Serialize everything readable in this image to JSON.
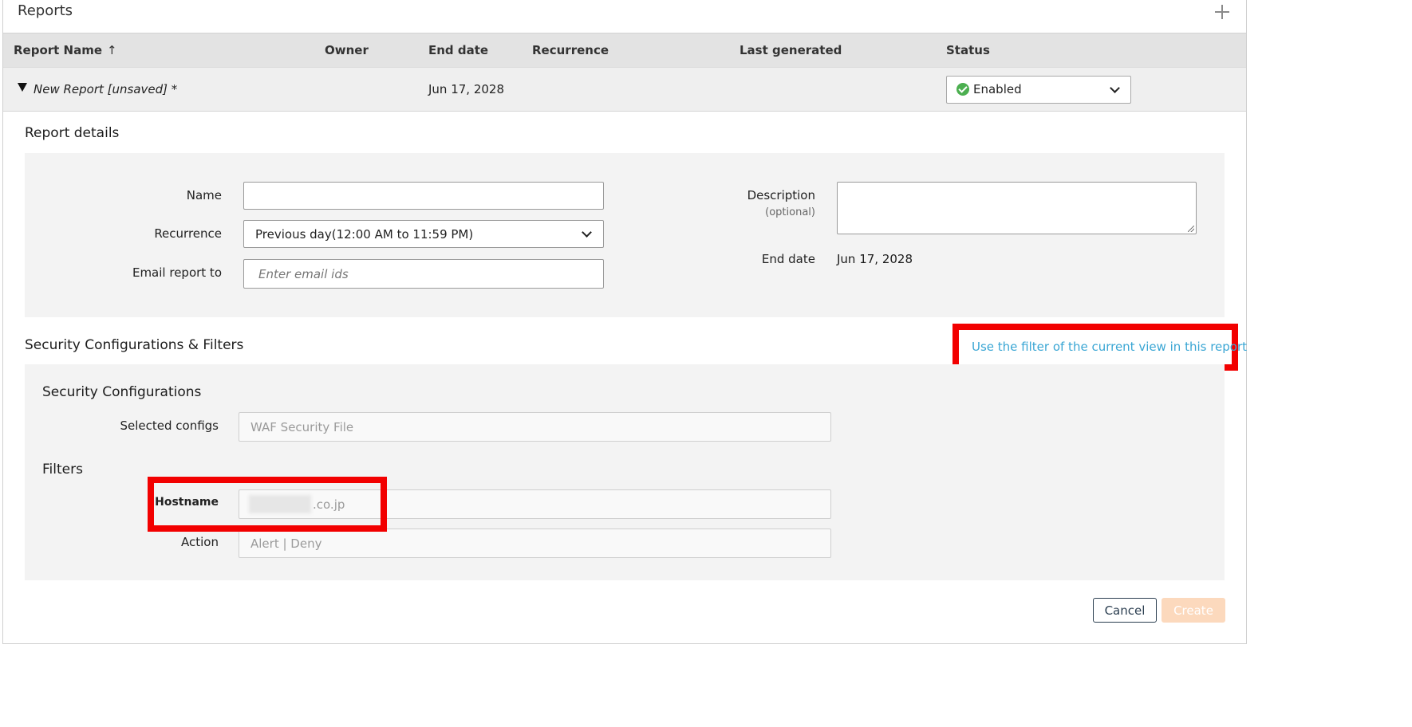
{
  "header": {
    "title": "Reports",
    "add_icon": "plus-icon"
  },
  "table": {
    "columns": [
      "Report Name",
      "Owner",
      "End date",
      "Recurrence",
      "Last generated",
      "Status"
    ],
    "sort_icon": "↑",
    "row": {
      "name": "New Report [unsaved] *",
      "owner": "",
      "end_date": "Jun 17, 2028",
      "recurrence": "",
      "last_generated": "",
      "status": "Enabled"
    }
  },
  "report_details": {
    "title": "Report details",
    "name_label": "Name",
    "name_value": "",
    "recurrence_label": "Recurrence",
    "recurrence_value": "Previous day(12:00 AM to 11:59 PM)",
    "email_label": "Email report to",
    "email_placeholder": "Enter email ids",
    "description_label": "Description",
    "description_sublabel": "(optional)",
    "end_date_label": "End date",
    "end_date_value": "Jun 17, 2028"
  },
  "security": {
    "title": "Security Configurations & Filters",
    "use_filter_link": "Use the filter of the current view in this report",
    "configs_title": "Security Configurations",
    "selected_configs_label": "Selected configs",
    "selected_configs_value": "WAF Security File",
    "filters_title": "Filters",
    "hostname_label": "Hostname",
    "hostname_value": ".co.jp",
    "action_label": "Action",
    "action_value": "Alert | Deny"
  },
  "footer": {
    "cancel_label": "Cancel",
    "create_label": "Create"
  },
  "colors": {
    "link": "#3aa6d4",
    "highlight": "#f20000",
    "create_disabled": "#fcd9bd",
    "status_ok": "#4caf50"
  }
}
